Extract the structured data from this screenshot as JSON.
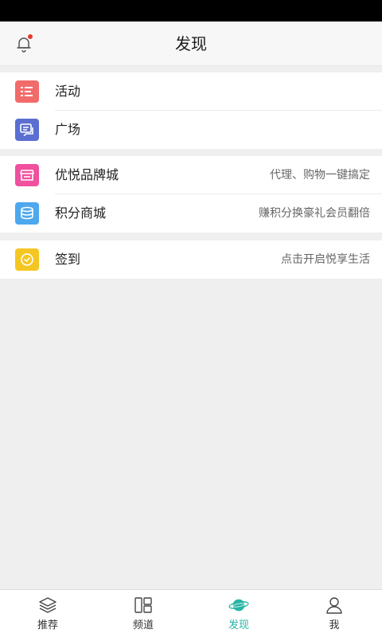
{
  "header": {
    "title": "发现"
  },
  "groups": [
    {
      "items": [
        {
          "label": "活动",
          "icon": "list-icon",
          "color": "#f26b6b"
        },
        {
          "label": "广场",
          "icon": "chat-icon",
          "color": "#5a6fd0"
        }
      ]
    },
    {
      "items": [
        {
          "label": "优悦品牌城",
          "desc": "代理、购物一键搞定",
          "icon": "store-icon",
          "color": "#f0509e"
        },
        {
          "label": "积分商城",
          "desc": "赚积分换豪礼会员翻倍",
          "icon": "coins-icon",
          "color": "#4ea8ee"
        }
      ]
    },
    {
      "items": [
        {
          "label": "签到",
          "desc": "点击开启悦享生活",
          "icon": "clock-icon",
          "color": "#f5c623"
        }
      ]
    }
  ],
  "tabbar": {
    "tabs": [
      {
        "label": "推荐",
        "icon": "layers-icon"
      },
      {
        "label": "频道",
        "icon": "grid-icon"
      },
      {
        "label": "发现",
        "icon": "planet-icon",
        "active": true
      },
      {
        "label": "我",
        "icon": "user-icon"
      }
    ],
    "active_color": "#26b5a5"
  }
}
